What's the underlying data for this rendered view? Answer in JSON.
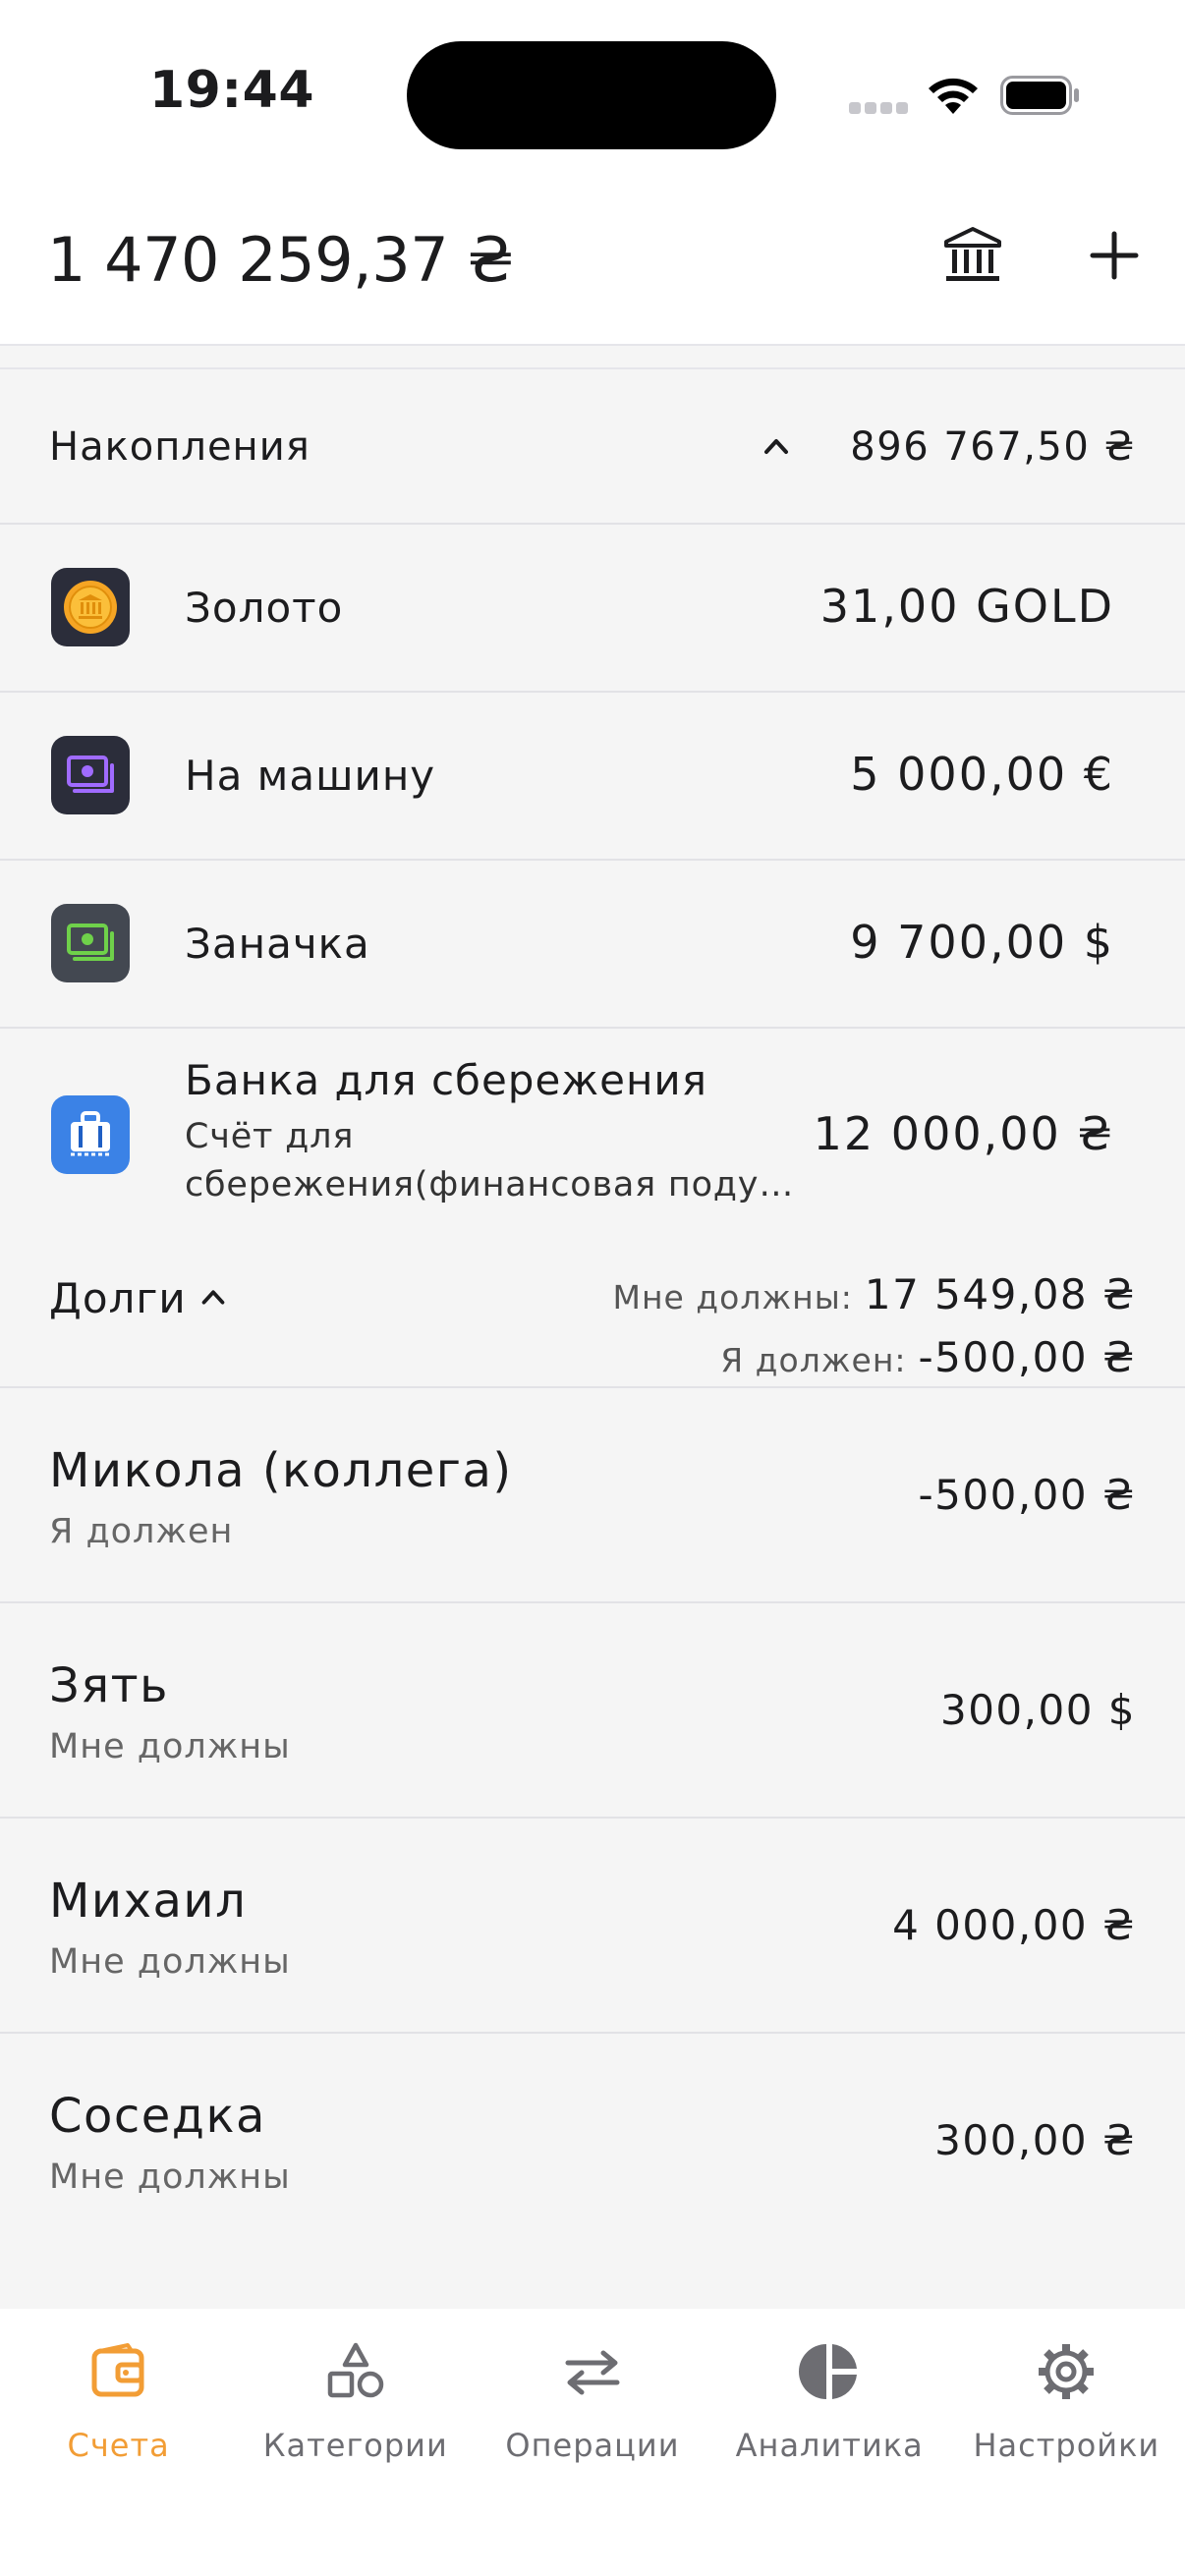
{
  "status_bar": {
    "time": "19:44"
  },
  "header": {
    "total_balance": "1 470 259,37 ₴"
  },
  "savings": {
    "title": "Накопления",
    "amount": "896 767,50 ₴",
    "accounts": [
      {
        "name": "Золото",
        "amount": "31,00 GOLD",
        "icon": "gold-coin-icon",
        "icon_bg": "#2b2d3a"
      },
      {
        "name": "На машину",
        "amount": "5 000,00 €",
        "icon": "cash-icon",
        "icon_bg": "#2b2d3a"
      },
      {
        "name": "Заначка",
        "amount": "9 700,00 $",
        "icon": "cash-icon",
        "icon_bg": "#434851"
      },
      {
        "name": "Банка для сбережения",
        "note_line1": "Счёт для",
        "note_line2": "сбережения(финансовая подушка)",
        "amount": "12 000,00 ₴",
        "icon": "suitcase-icon",
        "icon_bg": "#3b82e6"
      }
    ]
  },
  "debts": {
    "title": "Долги",
    "owed_to_me_label": "Мне должны:",
    "owed_to_me_value": "17 549,08 ₴",
    "i_owe_label": "Я должен:",
    "i_owe_value": "-500,00 ₴",
    "items": [
      {
        "name": "Микола (коллега)",
        "status": "Я должен",
        "amount": "-500,00 ₴"
      },
      {
        "name": "Зять",
        "status": "Мне должны",
        "amount": "300,00 $"
      },
      {
        "name": "Михаил",
        "status": "Мне должны",
        "amount": "4 000,00 ₴"
      },
      {
        "name": "Соседка",
        "status": "Мне должны",
        "amount": "300,00 ₴"
      }
    ]
  },
  "tabs": [
    {
      "label": "Счета",
      "icon": "wallet-icon",
      "active": true
    },
    {
      "label": "Категории",
      "icon": "shapes-icon",
      "active": false
    },
    {
      "label": "Операции",
      "icon": "transfer-arrows-icon",
      "active": false
    },
    {
      "label": "Аналитика",
      "icon": "pie-chart-icon",
      "active": false
    },
    {
      "label": "Настройки",
      "icon": "gear-icon",
      "active": false
    }
  ],
  "colors": {
    "accent": "#f29d35",
    "background": "#f5f5f5",
    "divider": "#e2e2e6"
  }
}
